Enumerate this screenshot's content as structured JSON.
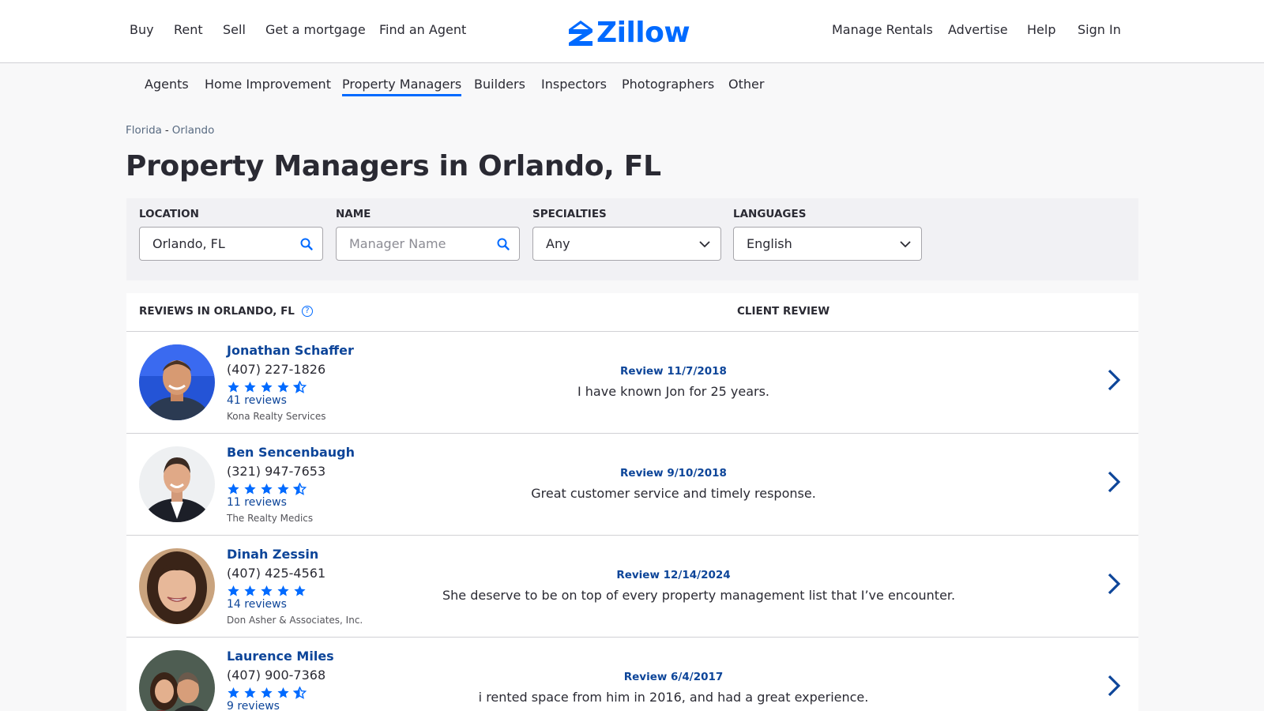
{
  "topnav": {
    "left_links": [
      "Buy",
      "Rent",
      "Sell",
      "Get a mortgage",
      "Find an Agent"
    ],
    "logo_text": "Zillow",
    "right_links": [
      "Manage Rentals",
      "Advertise",
      "Help",
      "Sign In"
    ],
    "brand_color": "#006aff"
  },
  "subnav": {
    "links": [
      "Agents",
      "Home Improvement",
      "Property Managers",
      "Builders",
      "Inspectors",
      "Photographers",
      "Other"
    ],
    "active": "Property Managers"
  },
  "breadcrumb": {
    "state": "Florida",
    "separator": "-",
    "city": "Orlando"
  },
  "page_title": "Property Managers in Orlando, FL",
  "filters": {
    "location": {
      "label": "LOCATION",
      "value": "Orlando, FL"
    },
    "name": {
      "label": "NAME",
      "placeholder": "Manager Name"
    },
    "specialties": {
      "label": "SPECIALTIES",
      "value": "Any"
    },
    "languages": {
      "label": "LANGUAGES",
      "value": "English"
    }
  },
  "results": {
    "header_left": "REVIEWS IN ORLANDO, FL",
    "header_right": "CLIENT REVIEW",
    "help_glyph": "?",
    "rows": [
      {
        "name": "Jonathan Schaffer",
        "phone": "(407) 227-1826",
        "rating": 4.5,
        "reviews": "41 reviews",
        "company": "Kona Realty Services",
        "review_date": "Review 11/7/2018",
        "review_text": "I have known Jon for 25 years."
      },
      {
        "name": "Ben Sencenbaugh",
        "phone": "(321) 947-7653",
        "rating": 4.5,
        "reviews": "11 reviews",
        "company": "The Realty Medics",
        "review_date": "Review 9/10/2018",
        "review_text": "Great customer service and timely response."
      },
      {
        "name": "Dinah Zessin",
        "phone": "(407) 425-4561",
        "rating": 5,
        "reviews": "14 reviews",
        "company": "Don Asher & Associates, Inc.",
        "review_date": "Review 12/14/2024",
        "review_text": "She deserve to be on top of every property management list that I’ve encounter."
      },
      {
        "name": "Laurence Miles",
        "phone": "(407) 900-7368",
        "rating": 4.5,
        "reviews": "9 reviews",
        "company": "",
        "review_date": "Review 6/4/2017",
        "review_text": "i rented space from him in 2016, and had a great experience."
      }
    ]
  }
}
